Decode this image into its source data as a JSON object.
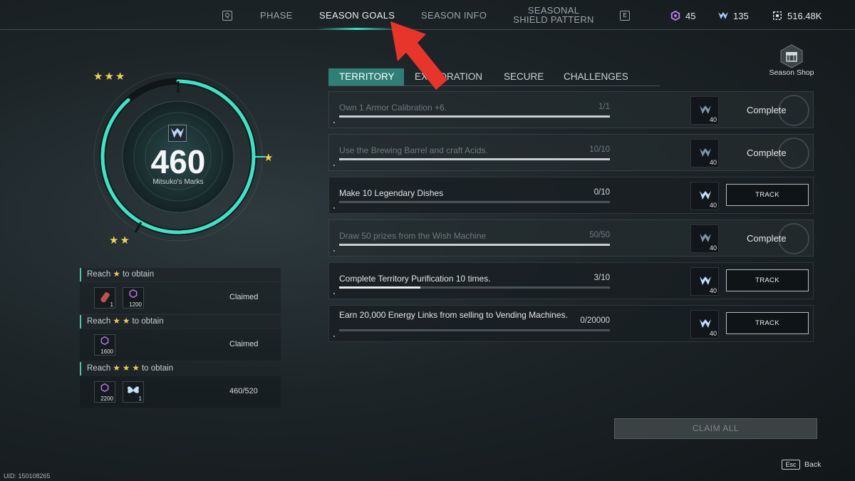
{
  "nav": {
    "left_key": "Q",
    "right_key": "E",
    "tabs": [
      {
        "label": "PHASE"
      },
      {
        "label": "SEASON GOALS"
      },
      {
        "label_line1": "SEASON INFO"
      },
      {
        "label_line1": "SEASONAL",
        "label_line2": "SHIELD PATTERN"
      }
    ],
    "active_tab": "SEASON GOALS"
  },
  "currencies": [
    {
      "icon": "purple-hexagon-icon",
      "value": "45",
      "color": "#c77dff"
    },
    {
      "icon": "mitsuko-mark-icon",
      "value": "135",
      "color": "#a9c6ff"
    },
    {
      "icon": "energy-link-icon",
      "value": "516.48K",
      "color": "#ffffff"
    }
  ],
  "gauge": {
    "value": "460",
    "label": "Mitsuko's Marks",
    "progress": 0.885,
    "accent": "#3fe2c6"
  },
  "rewards": [
    {
      "title_pre": "Reach",
      "stars": "★",
      "title_post": "to obtain",
      "items": [
        {
          "icon": "bullet-icon",
          "qty": "1"
        },
        {
          "icon": "purple-hexagon-icon",
          "qty": "1200"
        }
      ],
      "status": "Claimed"
    },
    {
      "title_pre": "Reach",
      "stars": "★ ★",
      "title_post": "to obtain",
      "items": [
        {
          "icon": "purple-hexagon-icon",
          "qty": "1600"
        }
      ],
      "status": "Claimed"
    },
    {
      "title_pre": "Reach",
      "stars": "★ ★ ★",
      "title_post": "to obtain",
      "items": [
        {
          "icon": "purple-hexagon-icon",
          "qty": "2200"
        },
        {
          "icon": "butterfly-icon",
          "qty": "1"
        }
      ],
      "status": "460/520"
    }
  ],
  "goal_tabs": [
    "TERRITORY",
    "EXPLORATION",
    "SECURE",
    "CHALLENGES"
  ],
  "active_goal_tab": "TERRITORY",
  "season_shop": "Season Shop",
  "goals": [
    {
      "text": "Own 1 Armor Calibration +6.",
      "count": "1/1",
      "progress": 1.0,
      "reward_qty": "40",
      "state": "Complete"
    },
    {
      "text": "Use the Brewing Barrel and craft Acids.",
      "count": "10/10",
      "progress": 1.0,
      "reward_qty": "40",
      "state": "Complete"
    },
    {
      "text": "Make 10 Legendary Dishes",
      "count": "0/10",
      "progress": 0.0,
      "reward_qty": "40",
      "state": "TRACK"
    },
    {
      "text": "Draw 50 prizes from the Wish Machine",
      "count": "50/50",
      "progress": 1.0,
      "reward_qty": "40",
      "state": "Complete"
    },
    {
      "text": "Complete Territory Purification 10 times.",
      "count": "3/10",
      "progress": 0.3,
      "reward_qty": "40",
      "state": "TRACK"
    },
    {
      "text": "Earn 20,000 Energy Links from selling to Vending Machines.",
      "count": "0/20000",
      "progress": 0.0,
      "reward_qty": "40",
      "state": "TRACK"
    }
  ],
  "claim_all": "CLAIM ALL",
  "back_key": "Esc",
  "back_label": "Back",
  "uid": "UID: 150108265"
}
